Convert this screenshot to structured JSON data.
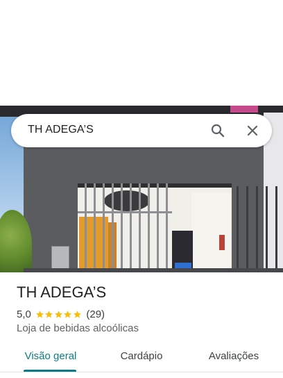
{
  "search": {
    "query": "TH ADEGA’S"
  },
  "place": {
    "title": "TH ADEGA’S",
    "rating": "5,0",
    "rating_stars": 5,
    "reviews": "(29)",
    "category": "Loja de bebidas alcoólicas"
  },
  "tabs": [
    {
      "label": "Visão geral",
      "active": true
    },
    {
      "label": "Cardápio",
      "active": false
    },
    {
      "label": "Avaliações",
      "active": false
    }
  ],
  "icons": {
    "search": "search-icon",
    "close": "close-icon",
    "star": "star-icon"
  },
  "colors": {
    "accent": "#0b7c86",
    "star": "#fbbc04",
    "text": "#202124"
  }
}
